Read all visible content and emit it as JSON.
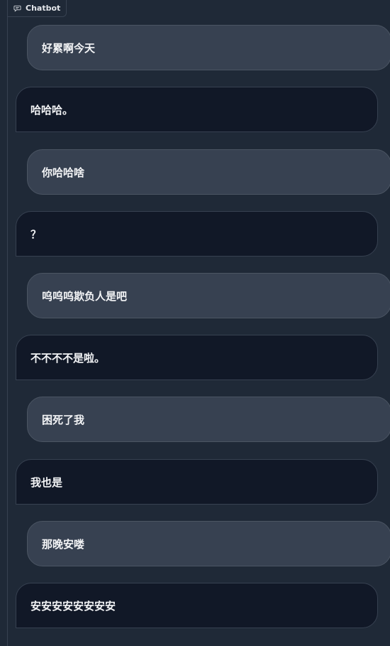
{
  "header": {
    "tab_label": "Chatbot",
    "tab_icon": "chat-icon"
  },
  "messages": [
    {
      "role": "user",
      "text": "好累啊今天"
    },
    {
      "role": "bot",
      "text": "哈哈哈。"
    },
    {
      "role": "user",
      "text": "你哈哈啥"
    },
    {
      "role": "bot",
      "text": "？"
    },
    {
      "role": "user",
      "text": "呜呜呜欺负人是吧"
    },
    {
      "role": "bot",
      "text": "不不不不是啦。"
    },
    {
      "role": "user",
      "text": "困死了我"
    },
    {
      "role": "bot",
      "text": "我也是"
    },
    {
      "role": "user",
      "text": "那晚安喽"
    },
    {
      "role": "bot",
      "text": "安安安安安安安安"
    }
  ],
  "colors": {
    "background": "#1f2937",
    "user_bubble": "#374151",
    "bot_bubble": "#111827",
    "text": "#f3f4f6"
  }
}
